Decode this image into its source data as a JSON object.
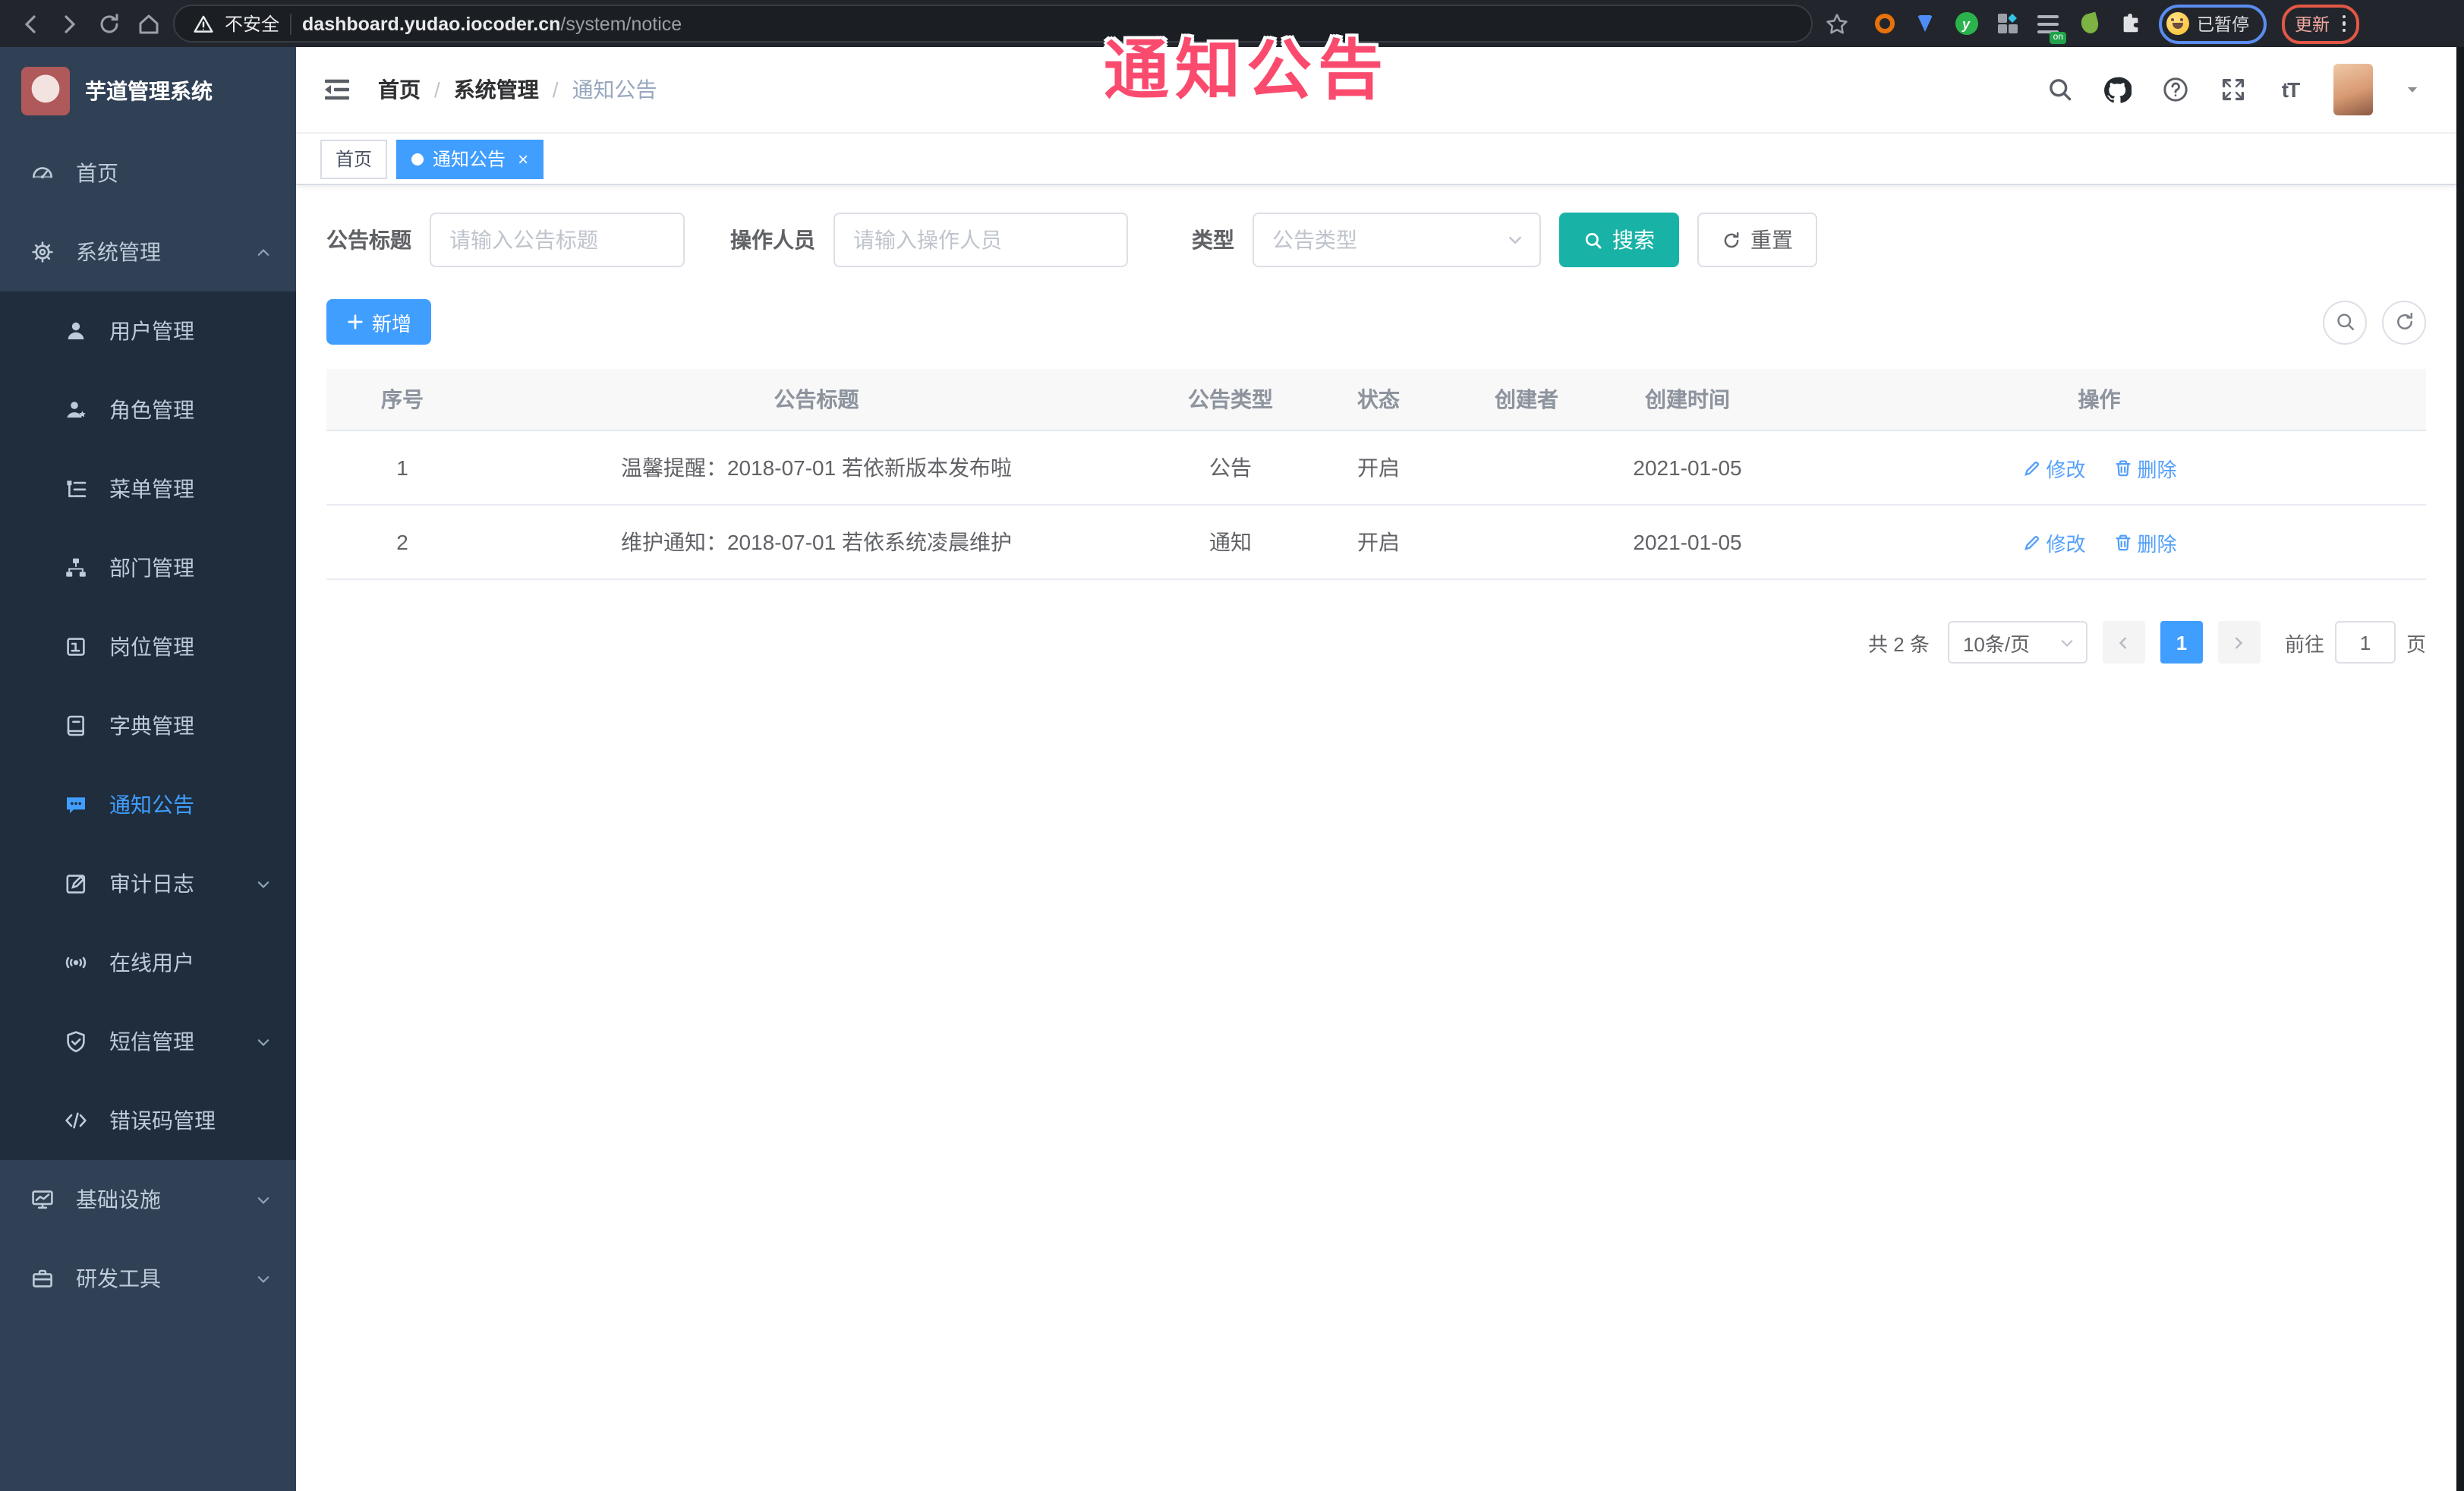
{
  "browser": {
    "security_label": "不安全",
    "url_host": "dashboard.yudao.iocoder.cn",
    "url_path": "/system/notice",
    "profile_chip_label": "已暂停",
    "update_label": "更新"
  },
  "overlay": {
    "text": "通知公告",
    "color": "#fa4b6e"
  },
  "sidebar": {
    "app_title": "芋道管理系统",
    "items": [
      {
        "label": "首页",
        "level": 1
      },
      {
        "label": "系统管理",
        "level": 1,
        "expanded": true
      },
      {
        "label": "用户管理",
        "level": 2
      },
      {
        "label": "角色管理",
        "level": 2
      },
      {
        "label": "菜单管理",
        "level": 2
      },
      {
        "label": "部门管理",
        "level": 2
      },
      {
        "label": "岗位管理",
        "level": 2
      },
      {
        "label": "字典管理",
        "level": 2
      },
      {
        "label": "通知公告",
        "level": 2,
        "active": true
      },
      {
        "label": "审计日志",
        "level": 2,
        "collapsible": true
      },
      {
        "label": "在线用户",
        "level": 2
      },
      {
        "label": "短信管理",
        "level": 2,
        "collapsible": true
      },
      {
        "label": "错误码管理",
        "level": 2
      },
      {
        "label": "基础设施",
        "level": 1,
        "collapsible": true
      },
      {
        "label": "研发工具",
        "level": 1,
        "collapsible": true
      }
    ]
  },
  "header": {
    "breadcrumb": {
      "0": "首页",
      "1": "系统管理",
      "2": "通知公告"
    }
  },
  "tabs": {
    "0": {
      "label": "首页"
    },
    "1": {
      "label": "通知公告"
    }
  },
  "filters": {
    "title_label": "公告标题",
    "title_placeholder": "请输入公告标题",
    "operator_label": "操作人员",
    "operator_placeholder": "请输入操作人员",
    "type_label": "类型",
    "type_placeholder": "公告类型",
    "search_label": "搜索",
    "reset_label": "重置"
  },
  "toolbar": {
    "add_label": "新增"
  },
  "table": {
    "columns": {
      "0": "序号",
      "1": "公告标题",
      "2": "公告类型",
      "3": "状态",
      "4": "创建者",
      "5": "创建时间",
      "6": "操作"
    },
    "rows": {
      "0": {
        "index": "1",
        "title": "温馨提醒：2018-07-01 若依新版本发布啦",
        "type": "公告",
        "status": "开启",
        "creator": "",
        "create_time": "2021-01-05"
      },
      "1": {
        "index": "2",
        "title": "维护通知：2018-07-01 若依系统凌晨维护",
        "type": "通知",
        "status": "开启",
        "creator": "",
        "create_time": "2021-01-05"
      }
    },
    "edit_label": "修改",
    "delete_label": "删除"
  },
  "pagination": {
    "total_text": "共 2 条",
    "page_size": "10条/页",
    "current_page": "1",
    "goto_label": "前往",
    "goto_value": "1",
    "page_unit": "页"
  },
  "colors": {
    "accent_blue": "#409eff",
    "search_teal": "#18b3a6",
    "sidebar_bg": "#304156",
    "submenu_bg": "#1f2d3d",
    "overlay_pink": "#fa4b6e"
  }
}
